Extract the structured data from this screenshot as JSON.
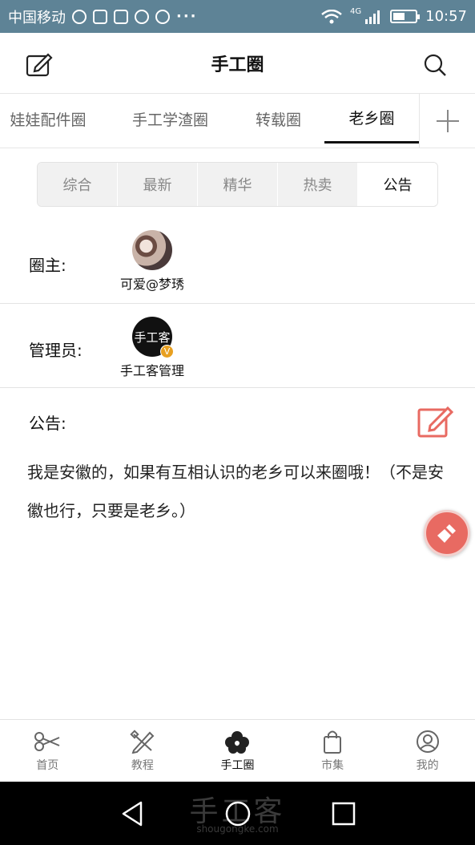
{
  "status_bar": {
    "carrier": "中国移动",
    "time": "10:57",
    "network": "4G"
  },
  "header": {
    "title": "手工圈",
    "edit_icon": "edit-icon",
    "search_icon": "search-icon"
  },
  "circle_tabs": {
    "items": [
      {
        "label": "娃娃配件圈",
        "active": false
      },
      {
        "label": "手工学渣圈",
        "active": false
      },
      {
        "label": "转载圈",
        "active": false
      },
      {
        "label": "老乡圈",
        "active": true
      }
    ],
    "add_icon": "plus-icon"
  },
  "segment": {
    "items": [
      {
        "label": "综合",
        "active": false
      },
      {
        "label": "最新",
        "active": false
      },
      {
        "label": "精华",
        "active": false
      },
      {
        "label": "热卖",
        "active": false
      },
      {
        "label": "公告",
        "active": true
      }
    ]
  },
  "owner": {
    "label": "圈主:",
    "name": "可爱@梦琇"
  },
  "admin": {
    "label": "管理员:",
    "name": "手工客管理",
    "avatar_text": "手工客",
    "badge": "V"
  },
  "notice": {
    "label": "公告:",
    "text": "我是安徽的，如果有互相认识的老乡可以来圈哦！（不是安徽也行，只要是老乡。）",
    "accent": "#e86a62"
  },
  "bottom_nav": {
    "items": [
      {
        "label": "首页",
        "icon": "scissors-icon",
        "active": false
      },
      {
        "label": "教程",
        "icon": "pencil-ruler-icon",
        "active": false
      },
      {
        "label": "手工圈",
        "icon": "flower-icon",
        "active": true
      },
      {
        "label": "市集",
        "icon": "shopping-bag-icon",
        "active": false
      },
      {
        "label": "我的",
        "icon": "user-icon",
        "active": false
      }
    ]
  },
  "watermark": {
    "text": "手工客",
    "url": "shougongke.com"
  }
}
